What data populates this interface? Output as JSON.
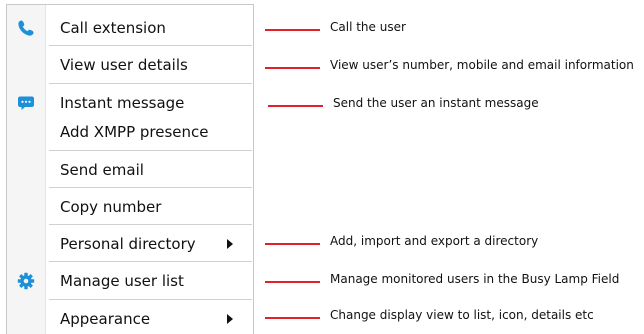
{
  "menu": {
    "items": [
      {
        "label": "Call extension",
        "icon": "phone-icon"
      },
      {
        "label": "View user details"
      },
      {
        "label": "Instant message",
        "icon": "chat-bubble-icon"
      },
      {
        "label": "Add XMPP presence"
      },
      {
        "label": "Send email"
      },
      {
        "label": "Copy number"
      },
      {
        "label": "Personal directory",
        "submenu": true
      },
      {
        "label": "Manage user list",
        "icon": "gear-icon"
      },
      {
        "label": "Appearance",
        "submenu": true
      }
    ]
  },
  "annotations": [
    "Call the user",
    "View user’s number, mobile and email information",
    "Send the user an instant message",
    "Add, import and export a directory",
    "Manage monitored users in the Busy Lamp Field",
    "Change display view to list, icon, details etc"
  ],
  "colors": {
    "icon_blue": "#1e90d8",
    "annotation_line": "#e0202a"
  }
}
